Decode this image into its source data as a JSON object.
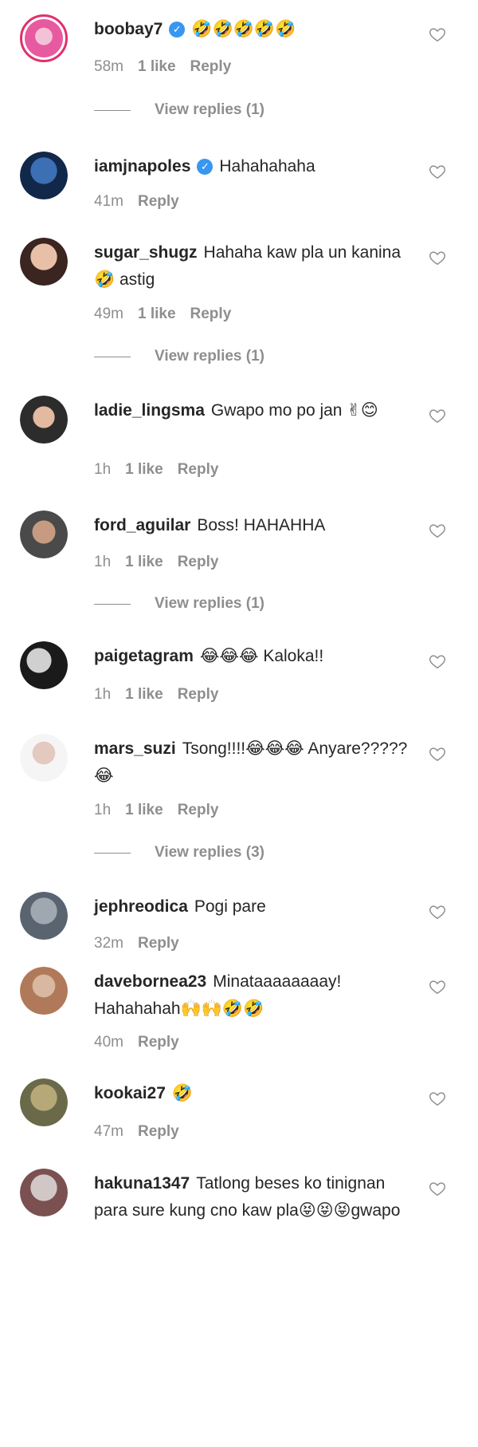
{
  "labels": {
    "reply": "Reply",
    "view_replies_prefix": "View replies"
  },
  "colors": {
    "username": "#262626",
    "meta": "#8e8e8e",
    "verified": "#3897f0",
    "story_ring": "#e1306c"
  },
  "comments": [
    {
      "username": "boobay7",
      "verified": true,
      "text": "🤣🤣🤣🤣🤣",
      "time": "58m",
      "likes": "1 like",
      "view_replies": "View replies (1)"
    },
    {
      "username": "iamjnapoles",
      "verified": true,
      "text": "Hahahahaha",
      "time": "41m",
      "likes": "",
      "view_replies": ""
    },
    {
      "username": "sugar_shugz",
      "verified": false,
      "text": "Hahaha kaw pla un kanina 🤣 astig",
      "time": "49m",
      "likes": "1 like",
      "view_replies": "View replies (1)"
    },
    {
      "username": "ladie_lingsma",
      "verified": false,
      "text": "Gwapo mo po jan ✌😊",
      "time": "1h",
      "likes": "1 like",
      "view_replies": ""
    },
    {
      "username": "ford_aguilar",
      "verified": false,
      "text": "Boss! HAHAHHA",
      "time": "1h",
      "likes": "1 like",
      "view_replies": "View replies (1)"
    },
    {
      "username": "paigetagram",
      "verified": false,
      "text": "😂😂😂 Kaloka!!",
      "time": "1h",
      "likes": "1 like",
      "view_replies": ""
    },
    {
      "username": "mars_suzi",
      "verified": false,
      "text": "Tsong!!!!😂😂😂 Anyare?????😂",
      "time": "1h",
      "likes": "1 like",
      "view_replies": "View replies (3)"
    },
    {
      "username": "jephreodica",
      "verified": false,
      "text": "Pogi pare",
      "time": "32m",
      "likes": "",
      "view_replies": ""
    },
    {
      "username": "davebornea23",
      "verified": false,
      "text": "Minataaaaaaaay! Hahahahah🙌🙌🤣🤣",
      "time": "40m",
      "likes": "",
      "view_replies": ""
    },
    {
      "username": "kookai27",
      "verified": false,
      "text": "🤣",
      "time": "47m",
      "likes": "",
      "view_replies": ""
    },
    {
      "username": "hakuna1347",
      "verified": false,
      "text": "Tatlong beses ko tinignan para sure kung cno kaw pla😝😝😝gwapo",
      "time": "",
      "likes": "",
      "view_replies": ""
    }
  ]
}
